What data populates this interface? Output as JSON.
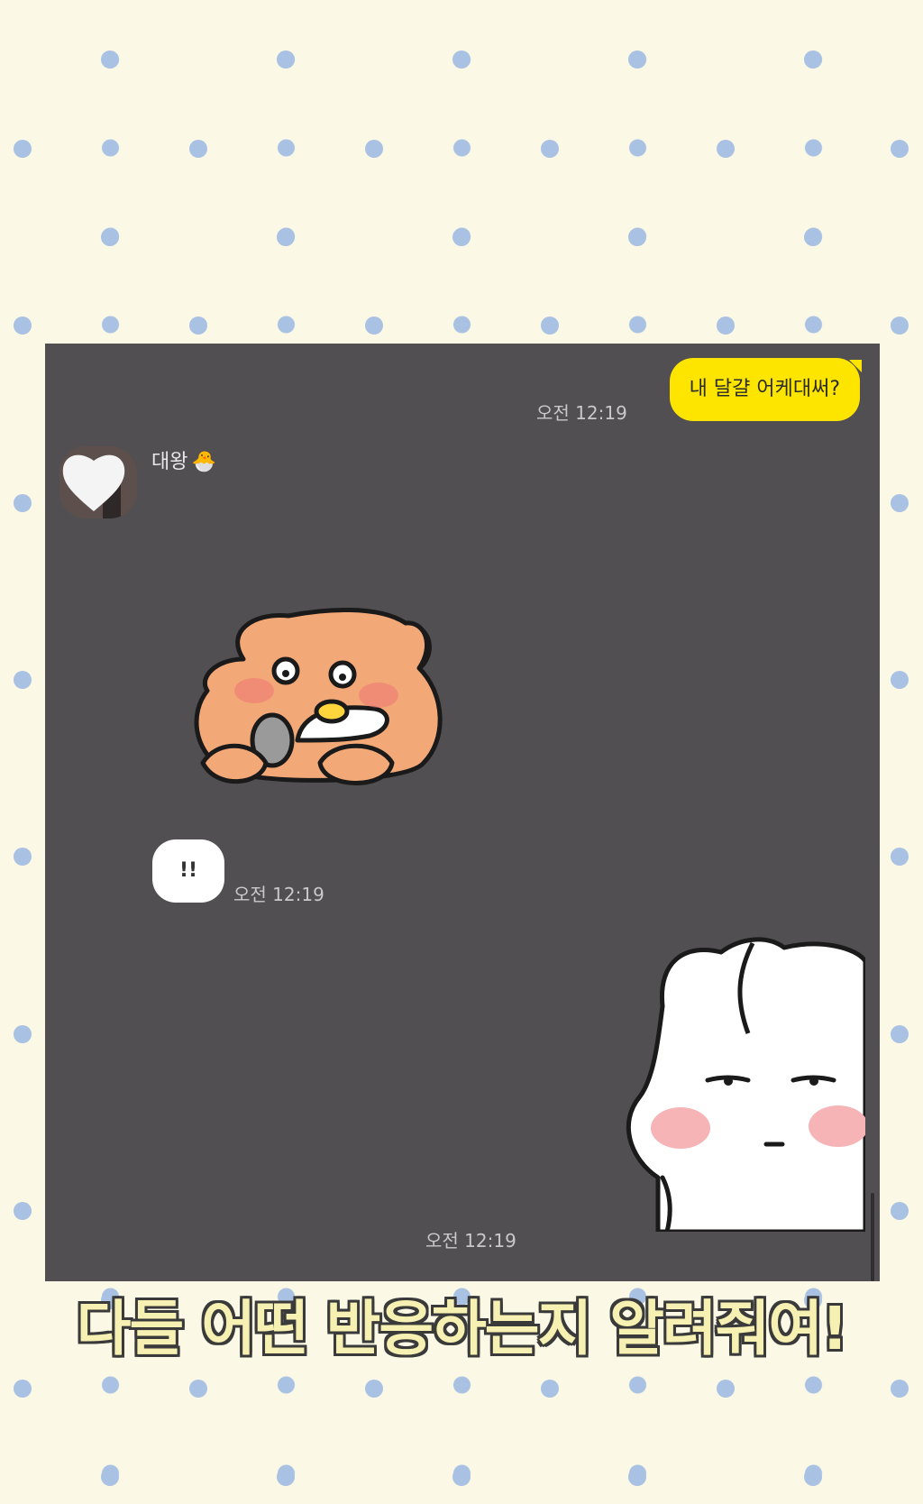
{
  "chat": {
    "my_message": "내 달걀 어케대써?",
    "my_message_time": "오전 12:19",
    "sender_name": "대왕",
    "sender_emoji": "🐣",
    "other_message": "!!",
    "other_message_time": "오전 12:19",
    "last_time": "오전 12:19"
  },
  "caption": "다들 어떤 반응하는지 알려줘여!",
  "colors": {
    "background": "#fbf9e6",
    "dots": "#a9c1e3",
    "chat_background": "#514f51",
    "my_bubble": "#fee500",
    "other_bubble": "#ffffff"
  }
}
